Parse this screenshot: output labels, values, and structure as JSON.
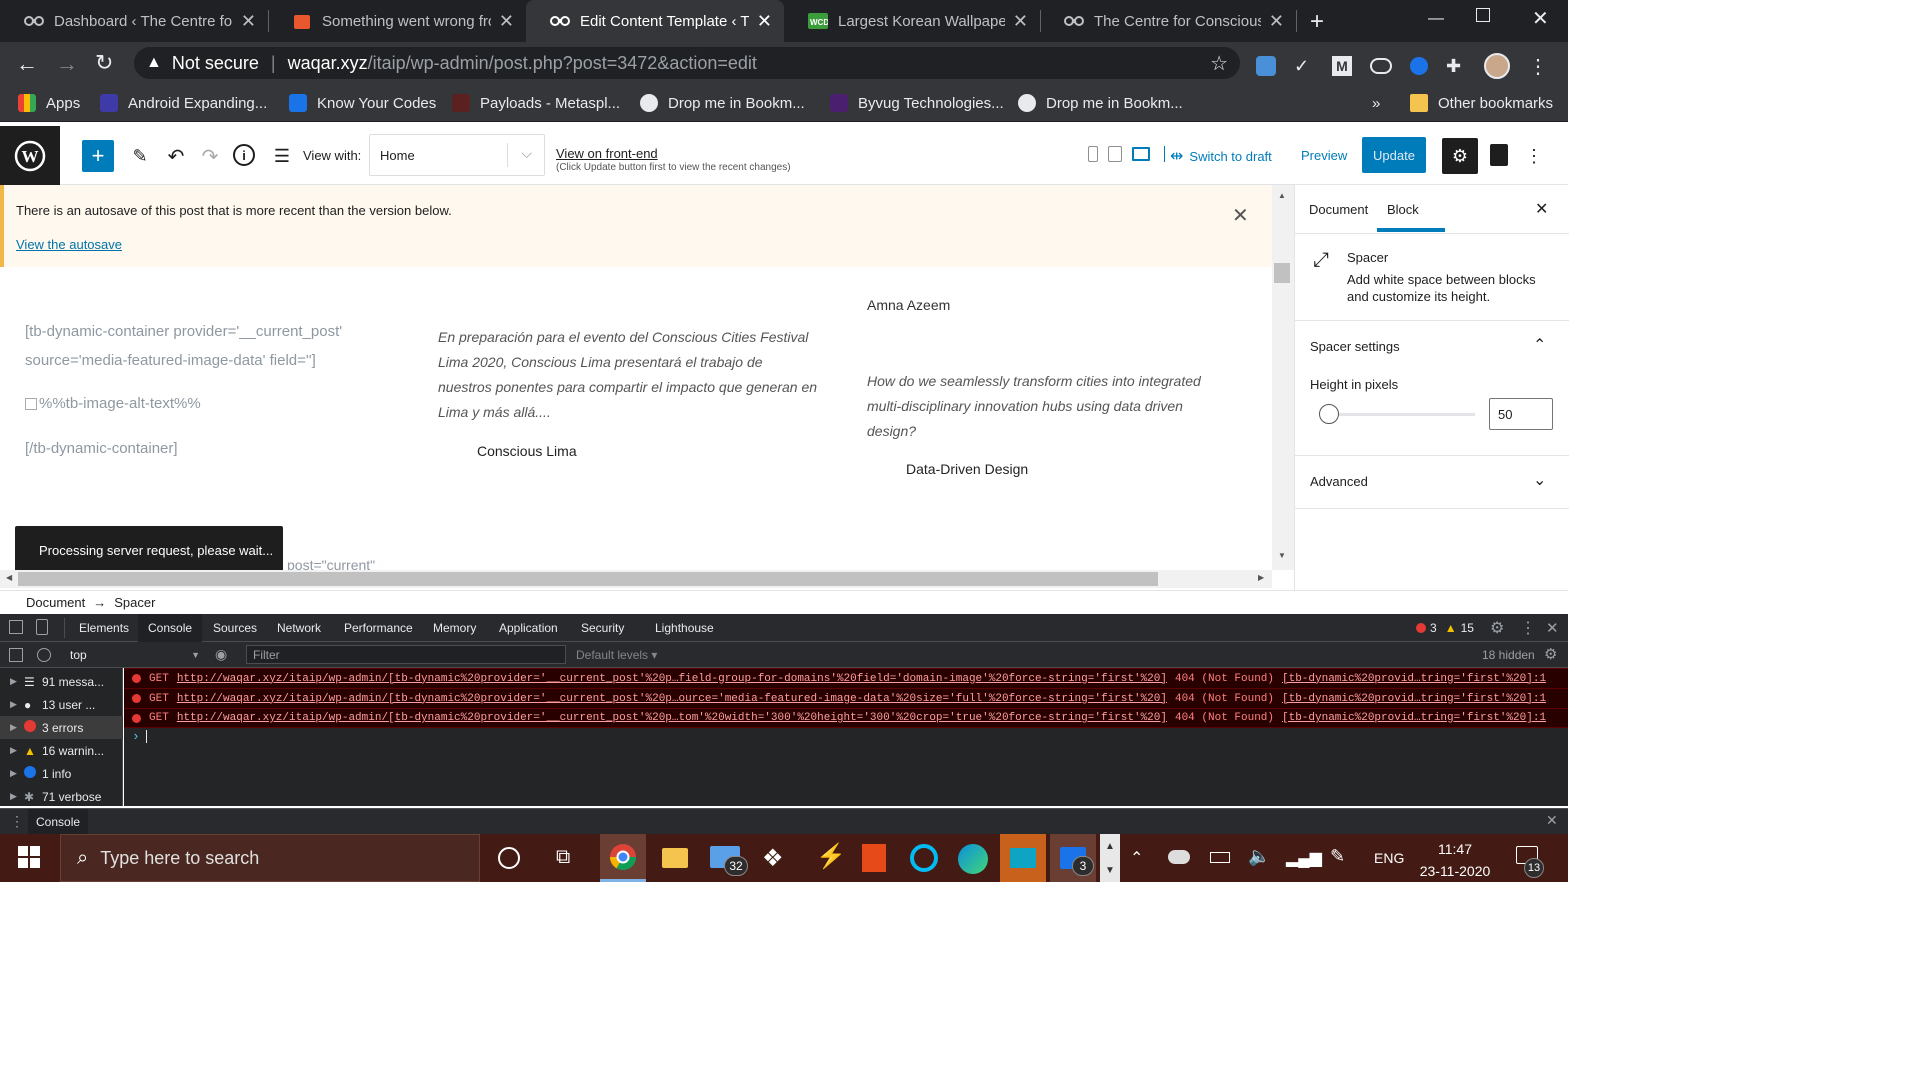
{
  "browser": {
    "tabs": [
      {
        "title": "Dashboard ‹ The Centre for",
        "icon": "wordpress-cc-icon",
        "active": false
      },
      {
        "title": "Something went wrong fro",
        "icon": "error-page-icon",
        "active": false
      },
      {
        "title": "Edit Content Template ‹ The",
        "icon": "wordpress-cc-icon",
        "active": true
      },
      {
        "title": "Largest Korean Wallpaper &",
        "icon": "wcd-icon",
        "active": false
      },
      {
        "title": "The Centre for Conscious D",
        "icon": "wordpress-cc-icon",
        "active": false
      }
    ],
    "security_label": "Not secure",
    "url_host": "waqar.xyz",
    "url_path": "/itaip/wp-admin/post.php?post=3472&action=edit",
    "bookmarks": [
      {
        "label": "Apps",
        "color": "#ea4335"
      },
      {
        "label": "Android Expanding...",
        "color": "#3e3aa8"
      },
      {
        "label": "Know Your Codes",
        "color": "#1a73e8"
      },
      {
        "label": "Payloads - Metaspl...",
        "color": "#5b2121"
      },
      {
        "label": "Drop me in Bookm...",
        "color": "#e8eaed"
      },
      {
        "label": "Byvug Technologies...",
        "color": "#4b1f6f"
      },
      {
        "label": "Drop me in Bookm...",
        "color": "#e8eaed"
      }
    ],
    "bookmarks_overflow": "»",
    "other_bookmarks": "Other bookmarks"
  },
  "editor": {
    "view_with_label": "View with:",
    "view_with_value": "Home",
    "view_frontend_link": "View on front-end",
    "view_frontend_note": "(Click Update button first to view the recent changes)",
    "switch_to_draft": "Switch to draft",
    "preview": "Preview",
    "update": "Update",
    "accent": "#007cba"
  },
  "notice": {
    "text": "There is an autosave of this post that is more recent than the version below.",
    "link": "View the autosave"
  },
  "content": {
    "col1": {
      "shortcode_open": "[tb-dynamic-container provider='__current_post' source='media-featured-image-data' field='']",
      "alt_text": "%%tb-image-alt-text%%",
      "shortcode_close": "[/tb-dynamic-container]"
    },
    "col2": {
      "excerpt": "En preparación para el evento del Conscious Cities Festival Lima 2020, Conscious Lima presentará el trabajo de nuestros ponentes para compartir el impacto que generan en Lima y más allá....",
      "author": "Conscious Lima"
    },
    "col3": {
      "author": "Amna Azeem",
      "excerpt": "How do we seamlessly transform cities into integrated multi-disciplinary innovation hubs using data driven design?",
      "tag": "Data-Driven Design"
    },
    "partial_text": "post=\"current\"",
    "toast": "Processing server request, please wait..."
  },
  "breadcrumb": {
    "root": "Document",
    "arrow": "→",
    "current": "Spacer"
  },
  "sidebar": {
    "tabs": [
      "Document",
      "Block"
    ],
    "active_tab": "Block",
    "block_name": "Spacer",
    "block_desc": "Add white space between blocks and customize its height.",
    "settings_title": "Spacer settings",
    "height_label": "Height in pixels",
    "height_value": "50",
    "advanced": "Advanced"
  },
  "devtools": {
    "tabs": [
      "Elements",
      "Console",
      "Sources",
      "Network",
      "Performance",
      "Memory",
      "Application",
      "Security",
      "Lighthouse"
    ],
    "active_tab": "Console",
    "error_count": "3",
    "warning_count": "15",
    "context": "top",
    "filter_placeholder": "Filter",
    "levels": "Default levels",
    "hidden": "18 hidden",
    "sidebar": [
      {
        "label": "91 messa...",
        "icon": "list-icon"
      },
      {
        "label": "13 user ...",
        "icon": "user-icon"
      },
      {
        "label": "3 errors",
        "icon": "error-icon"
      },
      {
        "label": "16 warnin...",
        "icon": "warning-icon"
      },
      {
        "label": "1 info",
        "icon": "info-icon"
      },
      {
        "label": "71 verbose",
        "icon": "verbose-icon"
      }
    ],
    "errors": [
      {
        "method": "GET",
        "url": "http://waqar.xyz/itaip/wp-admin/[tb-dynamic%20provider='__current_post'%20p…field-group-for-domains'%20field='domain-image'%20force-string='first'%20]",
        "status": "404 (Not Found)",
        "source": "[tb-dynamic%20provid…tring='first'%20]:1"
      },
      {
        "method": "GET",
        "url": "http://waqar.xyz/itaip/wp-admin/[tb-dynamic%20provider='__current_post'%20p…ource='media-featured-image-data'%20size='full'%20force-string='first'%20]",
        "status": "404 (Not Found)",
        "source": "[tb-dynamic%20provid…tring='first'%20]:1"
      },
      {
        "method": "GET",
        "url": "http://waqar.xyz/itaip/wp-admin/[tb-dynamic%20provider='__current_post'%20p…tom'%20width='300'%20height='300'%20crop='true'%20force-string='first'%20]",
        "status": "404 (Not Found)",
        "source": "[tb-dynamic%20provid…tring='first'%20]:1"
      }
    ],
    "prompt": "›",
    "drawer_tab": "Console"
  },
  "taskbar": {
    "search_placeholder": "Type here to search",
    "mail_badge": "32",
    "chat_badge": "3",
    "language": "ENG",
    "time": "11:47",
    "date": "23-11-2020",
    "notifications": "13"
  }
}
